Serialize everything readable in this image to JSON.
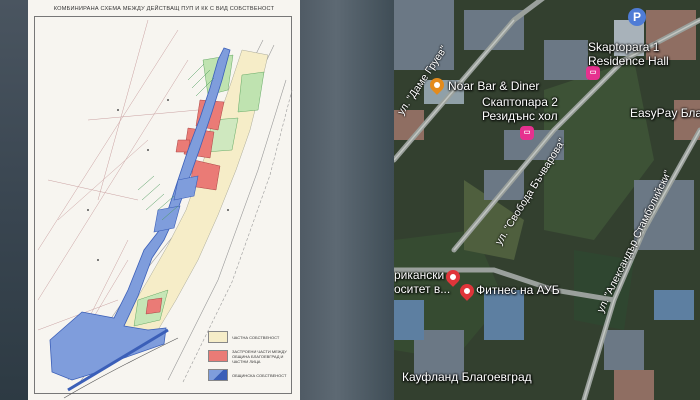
{
  "plan": {
    "title": "КОМБИНИРАНА СХЕМА МЕЖДУ ДЕЙСТВАЩ ПУП И КК С ВИД СОБСТВЕНОСТ",
    "legend": [
      {
        "label": "ЧАСТНА СОБСТВЕНОСТ",
        "color": "#f6edc8"
      },
      {
        "label": "ЗАСТРОЕНИ ЧАСТИ МЕЖДУ ОБЩИНА БЛАГОЕВГРАД И ЧАСТНИ ЛИЦА",
        "color": "#ea7b76"
      },
      {
        "label": "ОБЩИНСКА СОБСТВЕНОСТ",
        "color": "#7f9ddc"
      }
    ]
  },
  "map": {
    "labels": {
      "residence_en_1": "Skaptopara 1",
      "residence_en_2": "Residence Hall",
      "noar": "Noar Bar & Diner",
      "residence_bg_1": "Скаптопара 2",
      "residence_bg_2": "Резидънс хол",
      "easypay": "EasyPay Благ",
      "university_1": "рикански",
      "university_2": "оситет в...",
      "fitness": "Фитнес на АУБ",
      "kaufland": "Кауфланд Благоевград"
    },
    "streets": {
      "dame_gruev": "ул. \"Даме Груев\"",
      "svoboda": "ул. \"Свобода Бъчварова\"",
      "stamboliyski": "ул. \"Александър Стамболийски\""
    },
    "parking_symbol": "P",
    "colors": {
      "food_pin": "#e48b1c",
      "hotel_pin": "#e6318f",
      "university_pin": "#e0353a",
      "parking": "#4f7cd6"
    }
  }
}
